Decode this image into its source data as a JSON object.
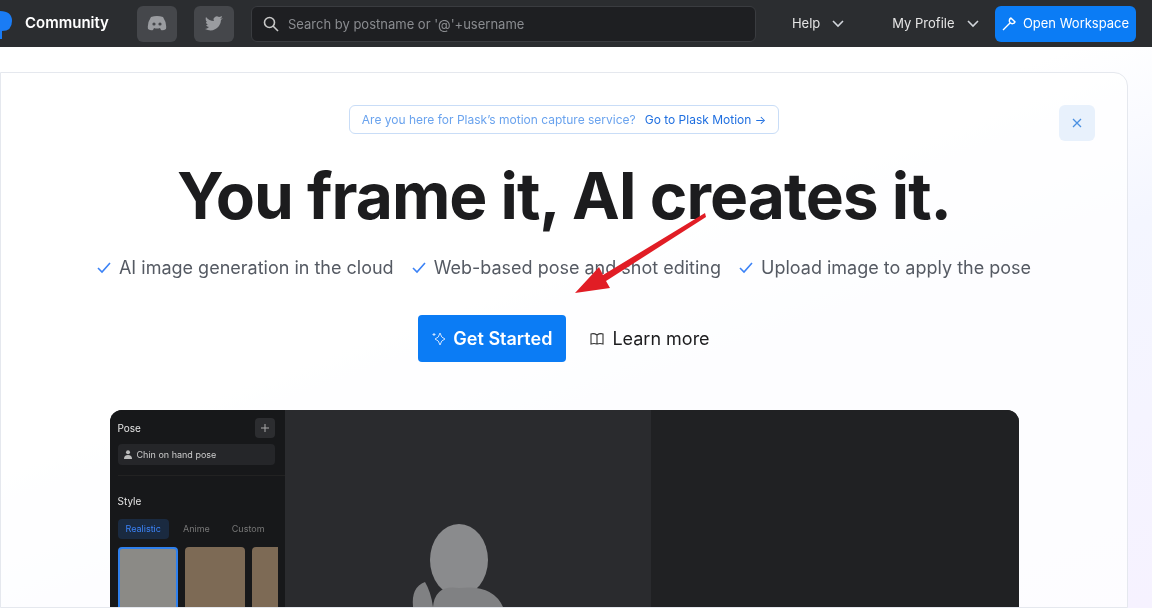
{
  "nav": {
    "brand": "Community",
    "search": {
      "placeholder": "Search by postname or '@'+username"
    },
    "menus": [
      "Help",
      "My Profile"
    ],
    "action": "Open Workspace"
  },
  "banner": {
    "question": "Are you here for Plask’s motion capture service?",
    "link": "Go to Plask Motion →"
  },
  "hero": {
    "title": "You frame it, AI creates it.",
    "features": [
      "AI image generation in the cloud",
      "Web-based pose and shot editing",
      "Upload image to apply the pose"
    ],
    "primary": "Get Started",
    "secondary": "Learn more"
  },
  "app": {
    "pose_title": "Pose",
    "pose_item": "Chin on hand pose",
    "style_title": "Style",
    "style_tabs": [
      {
        "label": "Realistic",
        "selected": true
      },
      {
        "label": "Anime",
        "selected": false
      },
      {
        "label": "Custom",
        "selected": false
      }
    ],
    "thumbnails": [
      {
        "selected": true
      },
      {
        "selected": false
      },
      {
        "selected": false
      }
    ]
  }
}
